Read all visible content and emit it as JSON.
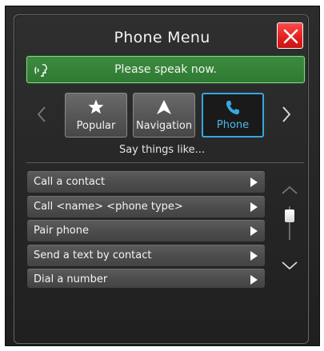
{
  "header": {
    "title": "Phone Menu"
  },
  "prompt": {
    "text": "Please speak now.",
    "icon": "voice-mic-icon"
  },
  "tabs": [
    {
      "label": "Popular",
      "icon": "star-icon",
      "active": false
    },
    {
      "label": "Navigation",
      "icon": "navigation-arrow-icon",
      "active": false
    },
    {
      "label": "Phone",
      "icon": "phone-icon",
      "active": true
    }
  ],
  "hint": "Say things like...",
  "commands": [
    {
      "label": "Call a contact"
    },
    {
      "label": "Call <name> <phone type>"
    },
    {
      "label": "Pair phone"
    },
    {
      "label": "Send a text by contact"
    },
    {
      "label": "Dial a number"
    }
  ],
  "colors": {
    "accent_blue": "#34a9dd",
    "speak_green": "#2f7a33",
    "close_red": "#e11f1f"
  }
}
